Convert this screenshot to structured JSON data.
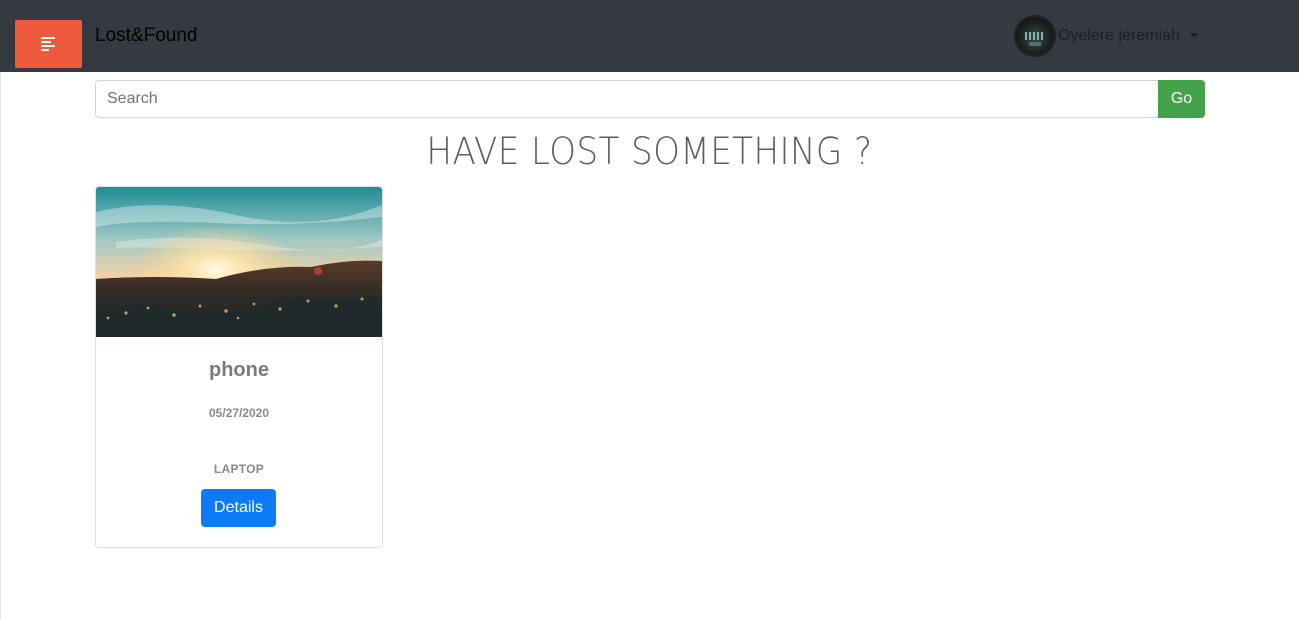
{
  "navbar": {
    "menu_icon": "hamburger-left-align-icon",
    "brand": "Lost&Found",
    "user": {
      "name": "Oyelere jeremiah",
      "dropdown_icon": "caret-down-icon"
    },
    "colors": {
      "background": "#343a40",
      "menu_button": "#f05a3c"
    }
  },
  "search": {
    "placeholder": "Search",
    "value": "",
    "button_label": "Go",
    "button_color": "#43a34a"
  },
  "heading": "HAVE LOST SOMETHING ?",
  "items": [
    {
      "image": "sunset-landscape-photo",
      "title": "phone",
      "date": "05/27/2020",
      "category": "LAPTOP",
      "button_label": "Details",
      "button_color": "#0d7bf5"
    }
  ]
}
